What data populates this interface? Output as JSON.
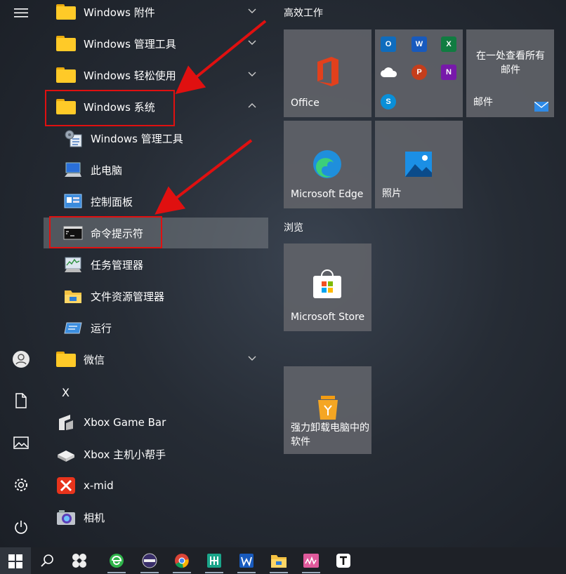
{
  "applist": {
    "items": [
      {
        "label": "Windows 附件",
        "type": "folder",
        "chevron": "down"
      },
      {
        "label": "Windows 管理工具",
        "type": "folder",
        "chevron": "down"
      },
      {
        "label": "Windows 轻松使用",
        "type": "folder",
        "chevron": "down"
      },
      {
        "label": "Windows 系统",
        "type": "folder",
        "chevron": "up"
      },
      {
        "label": "Windows 管理工具",
        "type": "app",
        "icon": "admin-tools-icon"
      },
      {
        "label": "此电脑",
        "type": "app",
        "icon": "this-pc-icon"
      },
      {
        "label": "控制面板",
        "type": "app",
        "icon": "control-panel-icon"
      },
      {
        "label": "命令提示符",
        "type": "app",
        "icon": "cmd-icon"
      },
      {
        "label": "任务管理器",
        "type": "app",
        "icon": "task-manager-icon"
      },
      {
        "label": "文件资源管理器",
        "type": "app",
        "icon": "file-explorer-icon"
      },
      {
        "label": "运行",
        "type": "app",
        "icon": "run-icon"
      },
      {
        "label": "微信",
        "type": "folder",
        "chevron": "down"
      },
      {
        "label": "Xbox Game Bar",
        "type": "app",
        "icon": "xbox-game-bar-icon"
      },
      {
        "label": "Xbox 主机小帮手",
        "type": "app",
        "icon": "xbox-console-icon"
      },
      {
        "label": "x-mid",
        "type": "app",
        "icon": "xmid-icon"
      },
      {
        "label": "相机",
        "type": "app",
        "icon": "camera-icon"
      }
    ],
    "letter_x": "X"
  },
  "tiles": {
    "group1_title": "高效工作",
    "group2_title": "浏览",
    "office": "Office",
    "mail_tile_text": "在一处查看所有邮件",
    "mail": "邮件",
    "edge": "Microsoft Edge",
    "photos": "照片",
    "store": "Microsoft Store",
    "uninstaller": "强力卸载电脑中的软件",
    "mini_apps": [
      {
        "letter": "O",
        "color": "#0f6cbd",
        "icon": "outlook-icon"
      },
      {
        "letter": "W",
        "color": "#185abd",
        "icon": "word-icon"
      },
      {
        "letter": "X",
        "color": "#107c41",
        "icon": "excel-icon"
      },
      {
        "letter": "",
        "color": "#ffffff",
        "icon": "onedrive-icon"
      },
      {
        "letter": "P",
        "color": "#c43e1c",
        "icon": "powerpoint-icon"
      },
      {
        "letter": "N",
        "color": "#7719aa",
        "icon": "onenote-icon"
      },
      {
        "letter": "S",
        "color": "#0a8fd8",
        "icon": "skype-icon"
      }
    ]
  },
  "taskbar": {
    "apps": [
      "start-icon",
      "search-icon",
      "fan-app-icon",
      "browser-green-icon",
      "media-app-icon",
      "chrome-icon",
      "app-teal-icon",
      "word-icon",
      "file-explorer-icon",
      "audio-app-icon",
      "typora-icon"
    ]
  },
  "annotation_color": "#e01010"
}
